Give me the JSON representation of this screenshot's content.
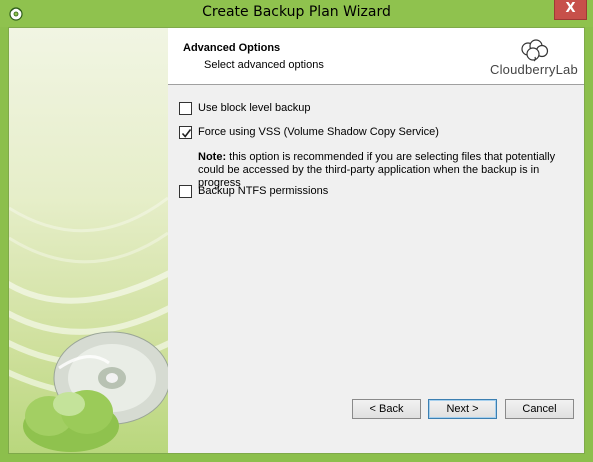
{
  "window": {
    "title": "Create Backup Plan Wizard",
    "close_label": "X"
  },
  "header": {
    "title": "Advanced Options",
    "subtitle": "Select advanced options",
    "logo_text": "CloudberryLab"
  },
  "options": [
    {
      "label": "Use block level backup",
      "checked": false
    },
    {
      "label": "Force using VSS (Volume Shadow Copy Service)",
      "checked": true
    },
    {
      "label": "Backup NTFS permissions",
      "checked": false
    }
  ],
  "note": {
    "prefix": "Note:",
    "text": "this option is recommended if you are selecting files that potentially could be accessed by the third-party application when the backup is in progress"
  },
  "buttons": {
    "back": "< Back",
    "next": "Next >",
    "cancel": "Cancel"
  },
  "colors": {
    "title_bar": "#8fc24e",
    "close_button": "#c7504a",
    "accent_green": "#7bb33a"
  }
}
